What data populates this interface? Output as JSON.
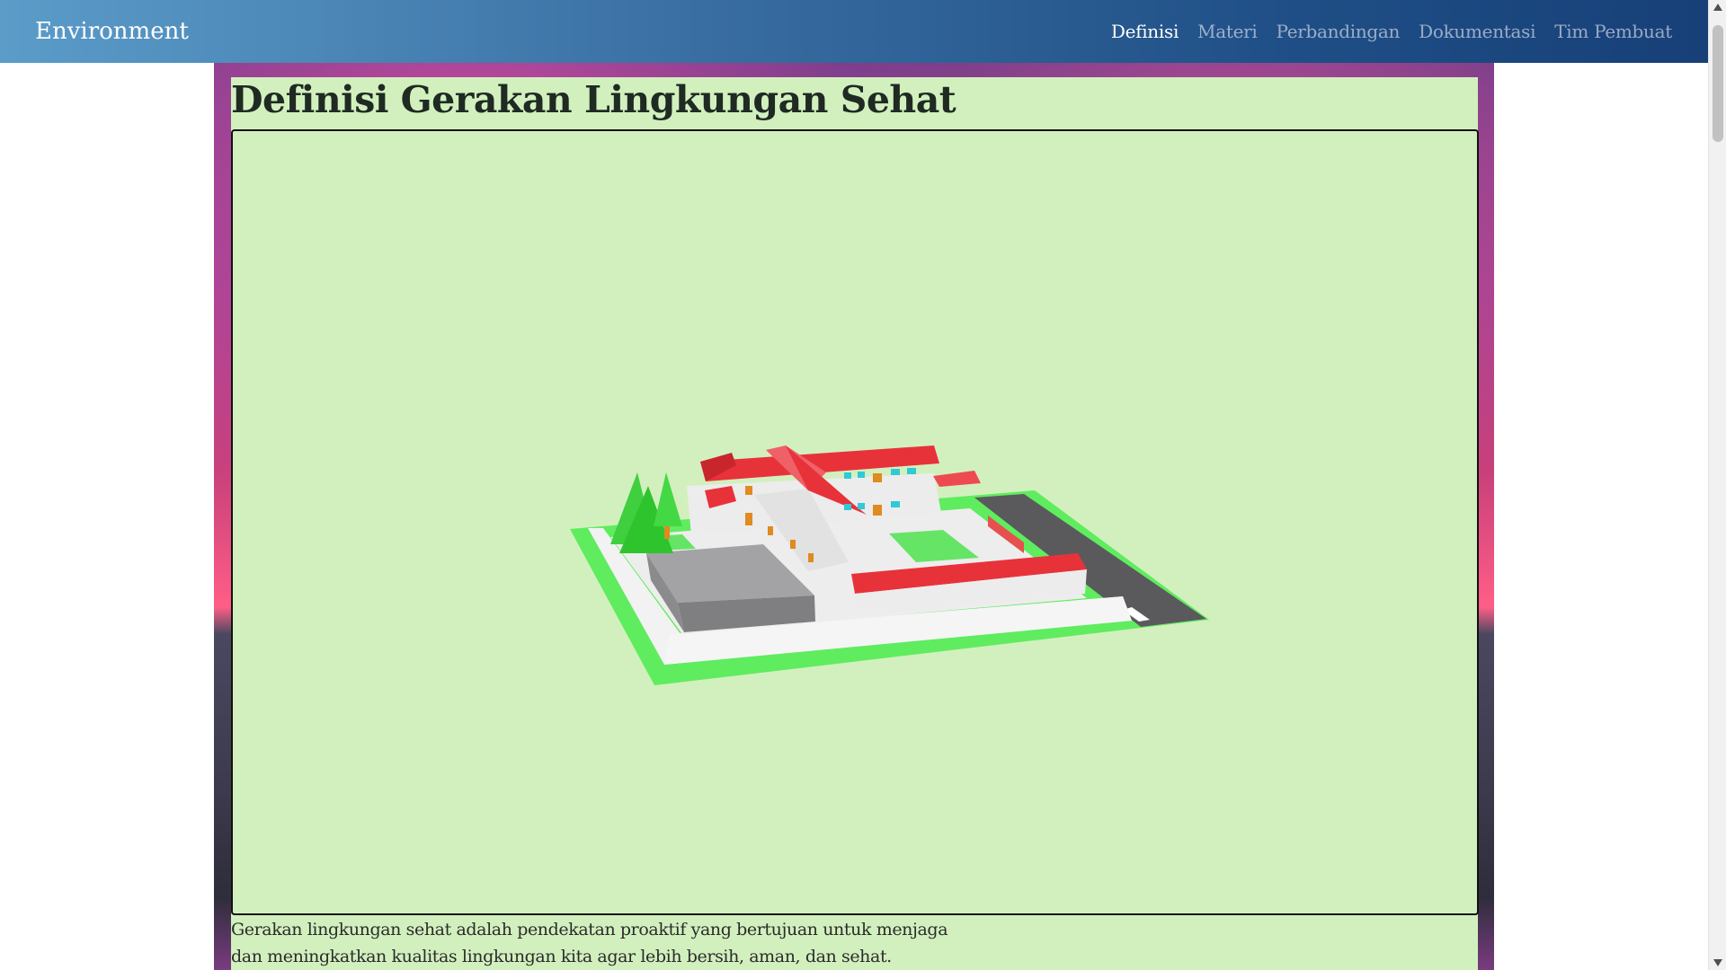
{
  "navbar": {
    "brand": "Environment",
    "links": [
      "Definisi",
      "Materi",
      "Perbandingan",
      "Dokumentasi",
      "Tim Pembuat"
    ]
  },
  "main": {
    "title": "Definisi Gerakan Lingkungan Sehat",
    "paragraph": "Gerakan lingkungan sehat adalah pendekatan proaktif yang bertujuan untuk menjaga dan meningkatkan kualitas lingkungan kita agar lebih bersih, aman, dan sehat.",
    "model_viewer": {
      "icon": "3d-school-model"
    }
  },
  "colors": {
    "navbar_start": "#5b9cc9",
    "navbar_end": "#173f78",
    "content_bg": "#d2f0be",
    "roof_red": "#e8323a",
    "grass_green": "#5ff05f"
  }
}
